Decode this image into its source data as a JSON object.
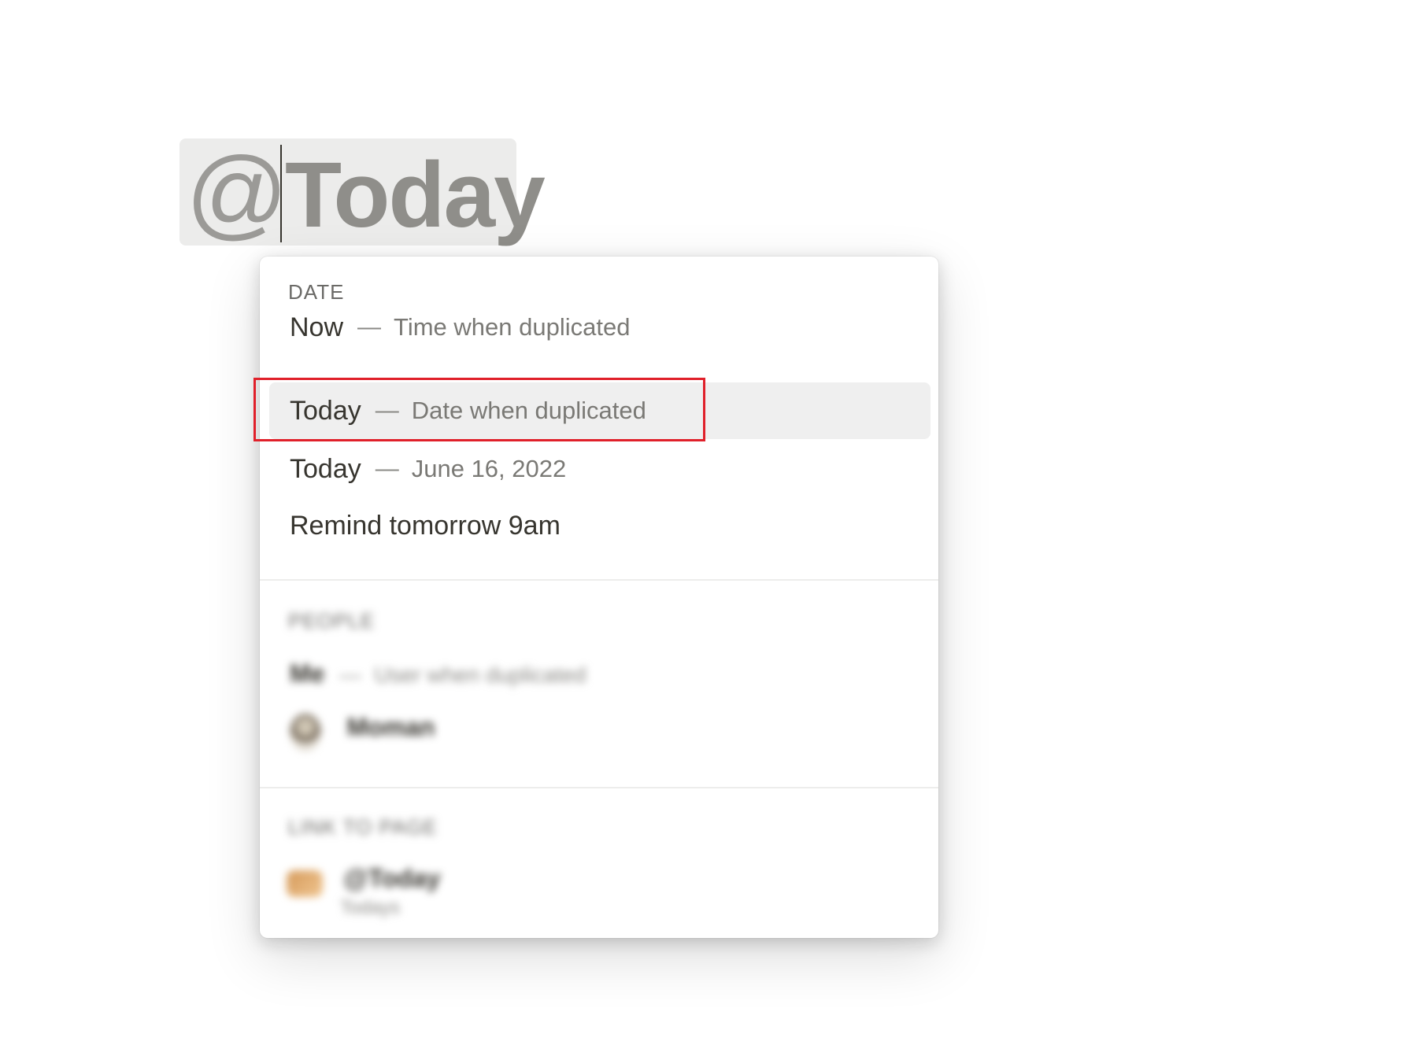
{
  "mention": {
    "at_symbol": "@",
    "typed_text": "Today"
  },
  "menu": {
    "date_section": {
      "heading": "DATE",
      "items": [
        {
          "title": "Now",
          "dash": "—",
          "description": "Time when duplicated"
        },
        {
          "title": "Today",
          "dash": "—",
          "description": "Date when duplicated",
          "selected": true
        },
        {
          "title": "Today",
          "dash": "—",
          "description": "June 16, 2022"
        },
        {
          "title": "Remind tomorrow 9am"
        }
      ]
    },
    "people_section": {
      "heading": "PEOPLE",
      "items": [
        {
          "title": "Me",
          "dash": "—",
          "description": "User when duplicated"
        },
        {
          "title": "Moman"
        }
      ]
    },
    "link_section": {
      "heading": "LINK TO PAGE",
      "items": [
        {
          "title": "@Today",
          "subtitle": "Todays"
        }
      ]
    }
  },
  "colors": {
    "highlight_border": "#e0202a",
    "selected_row": "#efefef",
    "chip_background": "#ececeb"
  }
}
